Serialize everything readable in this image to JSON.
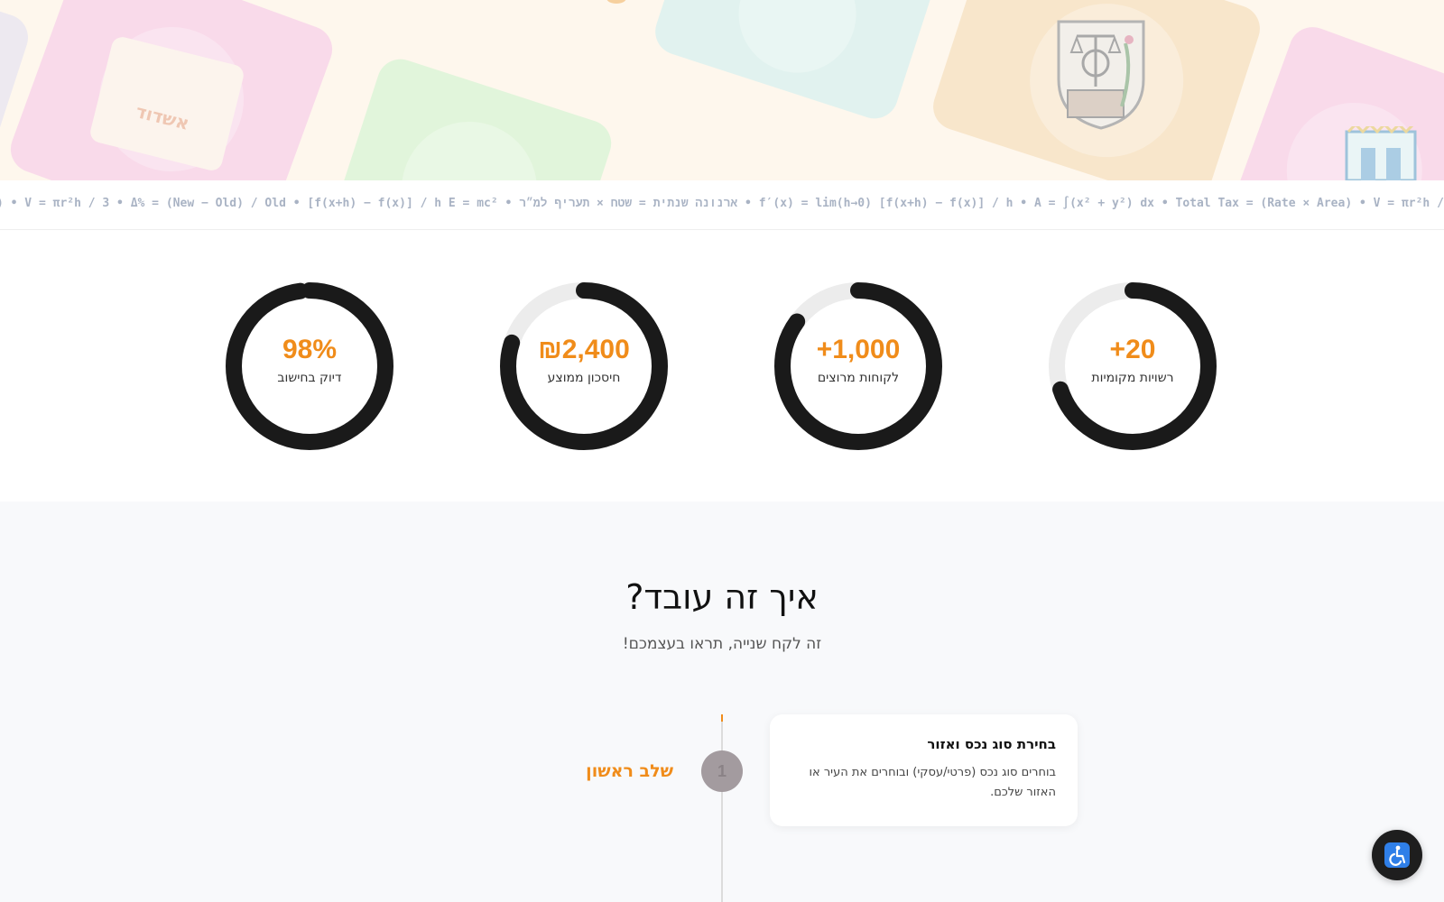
{
  "hero": {
    "logo_text": "אשדוד"
  },
  "ticker": {
    "text": ") • V = πr²h / 3 • Δ% = (New − Old) / Old • [f(x+h) − f(x)] / h    E = mc² • ארנונה שנתית = שטח × תעריף למ״ר • f′(x) = lim(h→0) [f(x+h) − f(x)] / h • A = ∫(x² + y²) dx • Total Tax = (Rate × Area) • V = πr²h /"
  },
  "stats": [
    {
      "value": "98%",
      "label": "דיוק בחישוב",
      "fill": 0.98
    },
    {
      "value": "₪2,400",
      "label": "חיסכון ממוצע",
      "fill": 0.8
    },
    {
      "value": "+1,000",
      "label": "לקוחות מרוצים",
      "fill": 0.85
    },
    {
      "value": "+20",
      "label": "רשויות מקומיות",
      "fill": 0.7
    }
  ],
  "how": {
    "title": "איך זה עובד?",
    "subtitle": "זה לקח שנייה, תראו בעצמכם!"
  },
  "steps": [
    {
      "number": "1",
      "name": "שלב ראשון",
      "title": "בחירת סוג נכס ואזור",
      "description": "בוחרים סוג נכס (פרטי/עסקי) ובוחרים את העיר או האזור שלכם."
    }
  ],
  "colors": {
    "accent": "#f08c1a",
    "ring": "#1a1a1a",
    "ring_track": "#ececec"
  },
  "icons": {
    "accessibility": "accessibility-icon"
  }
}
